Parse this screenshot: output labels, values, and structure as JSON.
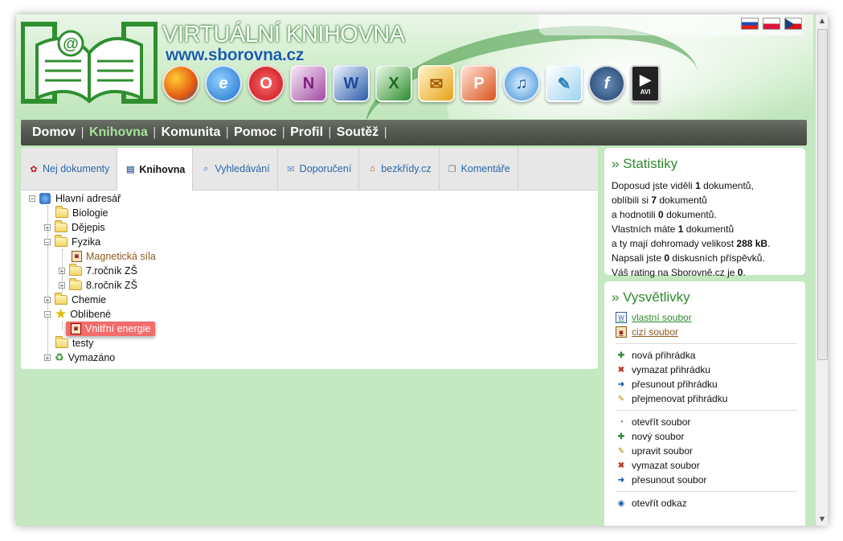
{
  "header": {
    "site_title": "VIRTUÁLNÍ KNIHOVNA",
    "site_url": "www.sborovna.cz",
    "app_icons": [
      "firefox-icon",
      "internet-explorer-icon",
      "opera-icon",
      "onenote-icon",
      "word-icon",
      "excel-icon",
      "outlook-icon",
      "powerpoint-icon",
      "itunes-icon",
      "feather-icon",
      "flash-icon",
      "avi-icon"
    ],
    "avi_label": "AVI",
    "flags": [
      "slovak-flag-icon",
      "polish-flag-icon",
      "czech-flag-icon"
    ]
  },
  "nav": {
    "items": [
      {
        "label": "Domov",
        "active": false
      },
      {
        "label": "Knihovna",
        "active": true
      },
      {
        "label": "Komunita",
        "active": false
      },
      {
        "label": "Pomoc",
        "active": false
      },
      {
        "label": "Profil",
        "active": false
      },
      {
        "label": "Soutěž",
        "active": false
      }
    ],
    "separator": "|"
  },
  "tabs": [
    {
      "label": "Nej dokumenty",
      "icon": "ribbon-icon",
      "active": false
    },
    {
      "label": "Knihovna",
      "icon": "book-icon",
      "active": true
    },
    {
      "label": "Vyhledávání",
      "icon": "magnifier-icon",
      "active": false
    },
    {
      "label": "Doporučení",
      "icon": "envelope-icon",
      "active": false
    },
    {
      "label": "bezkřídy.cz",
      "icon": "house-icon",
      "active": false
    },
    {
      "label": "Komentáře",
      "icon": "comment-icon",
      "active": false
    }
  ],
  "tree": {
    "root": "Hlavní adresář",
    "nodes": {
      "biologie": "Biologie",
      "dejepis": "Dějepis",
      "fyzika": "Fyzika",
      "magneticka": "Magnetická síla",
      "rocnik7": "7.ročník ZŠ",
      "rocnik8": "8.ročník ZŠ",
      "chemie": "Chemie",
      "oblibene": "Oblíbené",
      "vnitrni": "Vnitřní energie",
      "testy": "testy",
      "vymazano": "Vymazáno"
    }
  },
  "statistics": {
    "title": "» Statistiky",
    "line1_pre": "Doposud jste viděli ",
    "line1_val": "1",
    "line1_post": " dokumentů,",
    "line2_pre": "oblíbili si ",
    "line2_val": "7",
    "line2_post": " dokumentů",
    "line3_pre": "a hodnotili ",
    "line3_val": "0",
    "line3_post": " dokumentů.",
    "line4_pre": "Vlastních máte ",
    "line4_val": "1",
    "line4_post": " dokumentů",
    "line5_pre": "a ty mají dohromady velikost ",
    "line5_val": "288 kB",
    "line5_post": ".",
    "line6_pre": "Napsali jste ",
    "line6_val": "0",
    "line6_post": " diskusních příspěvků.",
    "line7_pre": "Váš rating na Sborovně.cz je ",
    "line7_val": "0",
    "line7_post": "."
  },
  "legend": {
    "title": "» Vysvětlivky",
    "own_file": "vlastní soubor",
    "foreign_file": "cizí soubor",
    "folder_actions": [
      "nová přihrádka",
      "vymazat přihrádku",
      "přesunout přihrádku",
      "přejmenovat přihrádku"
    ],
    "file_actions": [
      "otevřít soubor",
      "nový soubor",
      "upravit soubor",
      "vymazat soubor",
      "přesunout soubor"
    ],
    "link_actions": [
      "otevřít odkaz"
    ]
  },
  "colors": {
    "page_bg": "#c4e8c0",
    "nav_active": "#a6e39a",
    "accent_green": "#2e8b2e",
    "link_blue": "#2a67a8",
    "highlight_red": "#f36b6b"
  }
}
